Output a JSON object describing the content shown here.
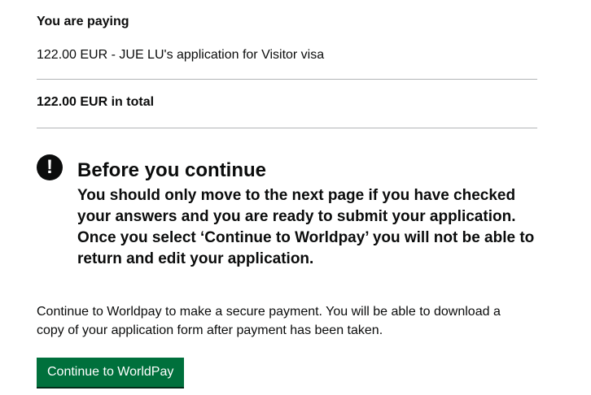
{
  "payment": {
    "heading": "You are paying",
    "line_item": "122.00 EUR - JUE LU's application for Visitor visa",
    "total": "122.00 EUR in total"
  },
  "warning": {
    "icon": "exclamation-icon",
    "icon_glyph": "!",
    "title": "Before you continue",
    "lines": [
      "You should only move to the next page if you have checked",
      "your answers and you are ready to submit your application.",
      "Once you select ‘Continue to Worldpay’ you will not be able to",
      "return and edit your application."
    ]
  },
  "info": {
    "lines": [
      "Continue to Worldpay to make a secure payment. You will be able to download a",
      "copy of your application form after payment has been taken."
    ]
  },
  "actions": {
    "continue_label": "Continue to WorldPay"
  },
  "colors": {
    "button_bg": "#00703c",
    "text": "#0b0c0c",
    "rule": "#b1b4b6"
  }
}
